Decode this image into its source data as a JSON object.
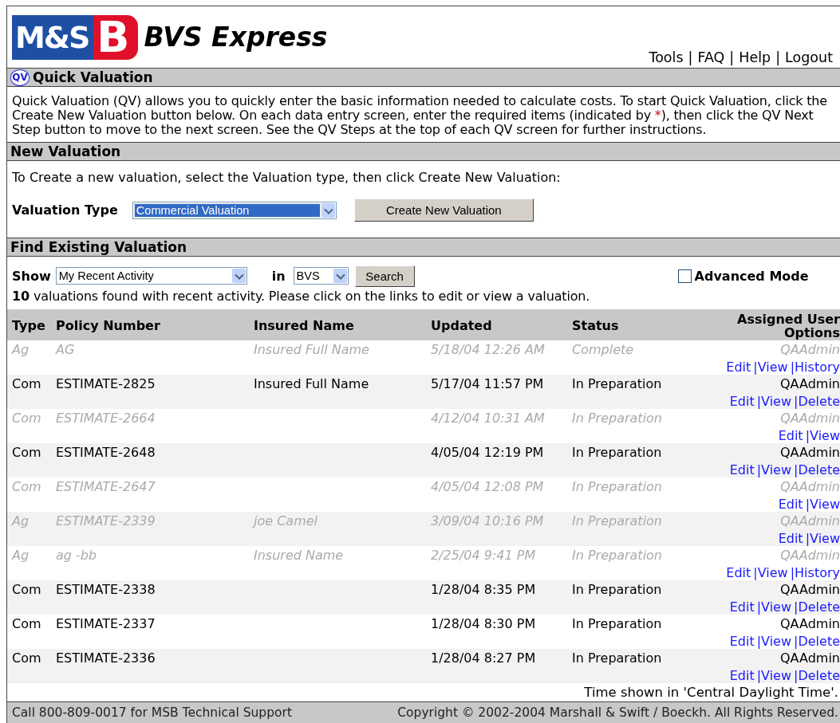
{
  "logo": {
    "mark_1": "M&S",
    "mark_2": "B",
    "product": "BVS Express"
  },
  "header_links": {
    "separator": "|",
    "items": [
      "Tools",
      "FAQ",
      "Help",
      "Logout"
    ]
  },
  "quick_valuation": {
    "badge": "QV",
    "title": "Quick Valuation",
    "description": [
      {
        "kind": "plain",
        "text": "Quick Valuation (QV) allows you to quickly enter the basic information needed to calculate costs. To start Quick Valuation, click the Create New Valuation button below. On each data entry screen, enter the required items (indicated by "
      },
      {
        "kind": "required",
        "text": "*"
      },
      {
        "kind": "plain",
        "text": "), then click the QV Next Step button to move to the next screen. See the QV Steps at the top of each QV screen for further instructions."
      }
    ]
  },
  "new_valuation": {
    "title": "New Valuation",
    "instruction": "To Create a new valuation, select the Valuation type, then click Create New Valuation:",
    "type_label": "Valuation Type",
    "type_value": "Commercial Valuation",
    "button": "Create New Valuation"
  },
  "find_existing": {
    "title": "Find Existing Valuation",
    "show_label": "Show",
    "show_value": "My Recent Activity",
    "in_label": "in",
    "in_value": "BVS",
    "search_button": "Search",
    "advanced_mode": {
      "label": "Advanced Mode",
      "checked": false
    },
    "summary": "**10** valuations found with recent activity. Please click on the links to edit or view a valuation."
  },
  "table": {
    "columns": [
      "Type",
      "Policy Number",
      "Insured Name",
      "Updated",
      "Status",
      "Assigned User Options"
    ],
    "option_separator": "|",
    "rows": [
      {
        "dimmed": true,
        "type": "Ag",
        "policy": "AG",
        "insured": "Insured Full Name",
        "updated": "5/18/04 12:26 AM",
        "status": "Complete",
        "user": "QAAdmin",
        "options": [
          "Edit",
          "View",
          "History"
        ]
      },
      {
        "dimmed": false,
        "type": "Com",
        "policy": "ESTIMATE-2825",
        "insured": "Insured Full Name",
        "updated": "5/17/04 11:57 PM",
        "status": "In Preparation",
        "user": "QAAdmin",
        "options": [
          "Edit",
          "View",
          "Delete"
        ]
      },
      {
        "dimmed": true,
        "type": "Com",
        "policy": "ESTIMATE-2664",
        "updated": "4/12/04 10:31 AM",
        "status": "In Preparation",
        "user": "QAAdmin",
        "options": [
          "Edit",
          "View"
        ]
      },
      {
        "dimmed": false,
        "type": "Com",
        "policy": "ESTIMATE-2648",
        "updated": "4/05/04 12:19 PM",
        "status": "In Preparation",
        "user": "QAAdmin",
        "options": [
          "Edit",
          "View",
          "Delete"
        ]
      },
      {
        "dimmed": true,
        "type": "Com",
        "policy": "ESTIMATE-2647",
        "updated": "4/05/04 12:08 PM",
        "status": "In Preparation",
        "user": "QAAdmin",
        "options": [
          "Edit",
          "View"
        ]
      },
      {
        "dimmed": true,
        "type": "Ag",
        "policy": "ESTIMATE-2339",
        "insured": "joe Camel",
        "updated": "3/09/04 10:16 PM",
        "status": "In Preparation",
        "user": "QAAdmin",
        "options": [
          "Edit",
          "View"
        ]
      },
      {
        "dimmed": true,
        "type": "Ag",
        "policy": "ag -bb",
        "insured": "Insured Name",
        "updated": "2/25/04 9:41 PM",
        "status": "In Preparation",
        "user": "QAAdmin",
        "options": [
          "Edit",
          "View",
          "History"
        ]
      },
      {
        "dimmed": false,
        "type": "Com",
        "policy": "ESTIMATE-2338",
        "updated": "1/28/04 8:35 PM",
        "status": "In Preparation",
        "user": "QAAdmin",
        "options": [
          "Edit",
          "View",
          "Delete"
        ]
      },
      {
        "dimmed": false,
        "type": "Com",
        "policy": "ESTIMATE-2337",
        "updated": "1/28/04 8:30 PM",
        "status": "In Preparation",
        "user": "QAAdmin",
        "options": [
          "Edit",
          "View",
          "Delete"
        ]
      },
      {
        "dimmed": false,
        "type": "Com",
        "policy": "ESTIMATE-2336",
        "updated": "1/28/04 8:27 PM",
        "status": "In Preparation",
        "user": "QAAdmin",
        "options": [
          "Edit",
          "View",
          "Delete"
        ]
      }
    ],
    "timezone_note": "Time shown in 'Central Daylight Time'."
  },
  "status_bar": {
    "support": "Call 800-809-0017 for MSB Technical Support",
    "copyright": "Copyright © 2002-2004 Marshall & Swift / Boeckh. All Rights Reserved."
  }
}
